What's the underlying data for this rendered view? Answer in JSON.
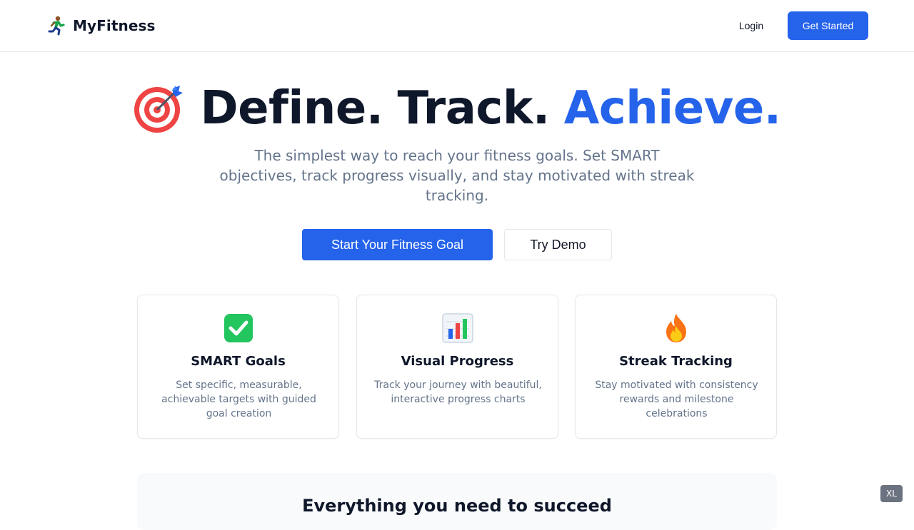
{
  "header": {
    "brand_name": "MyFitness",
    "brand_icon": "runner-icon",
    "login_label": "Login",
    "cta_label": "Get Started"
  },
  "hero": {
    "icon": "target-icon",
    "title_part1": "Define.",
    "title_part2": "Track.",
    "title_accent": "Achieve.",
    "subtitle": "The simplest way to reach your fitness goals. Set SMART objectives, track progress visually, and stay motivated with streak tracking.",
    "primary_button": "Start Your Fitness Goal",
    "secondary_button": "Try Demo"
  },
  "features": [
    {
      "icon": "check-icon",
      "title": "SMART Goals",
      "description": "Set specific, measurable, achievable targets with guided goal creation"
    },
    {
      "icon": "bar-chart-icon",
      "title": "Visual Progress",
      "description": "Track your journey with beautiful, interactive progress charts"
    },
    {
      "icon": "fire-icon",
      "title": "Streak Tracking",
      "description": "Stay motivated with consistency rewards and milestone celebrations"
    }
  ],
  "section": {
    "title": "Everything you need to succeed"
  },
  "breakpoint_badge": "XL",
  "colors": {
    "accent": "#2563eb",
    "text_primary": "#0f172a",
    "text_muted": "#64748b",
    "border": "#e5e7eb",
    "section_bg": "#f9fafb",
    "check_green": "#22c55e",
    "target_red": "#ef4444",
    "fire_orange": "#f97316"
  }
}
